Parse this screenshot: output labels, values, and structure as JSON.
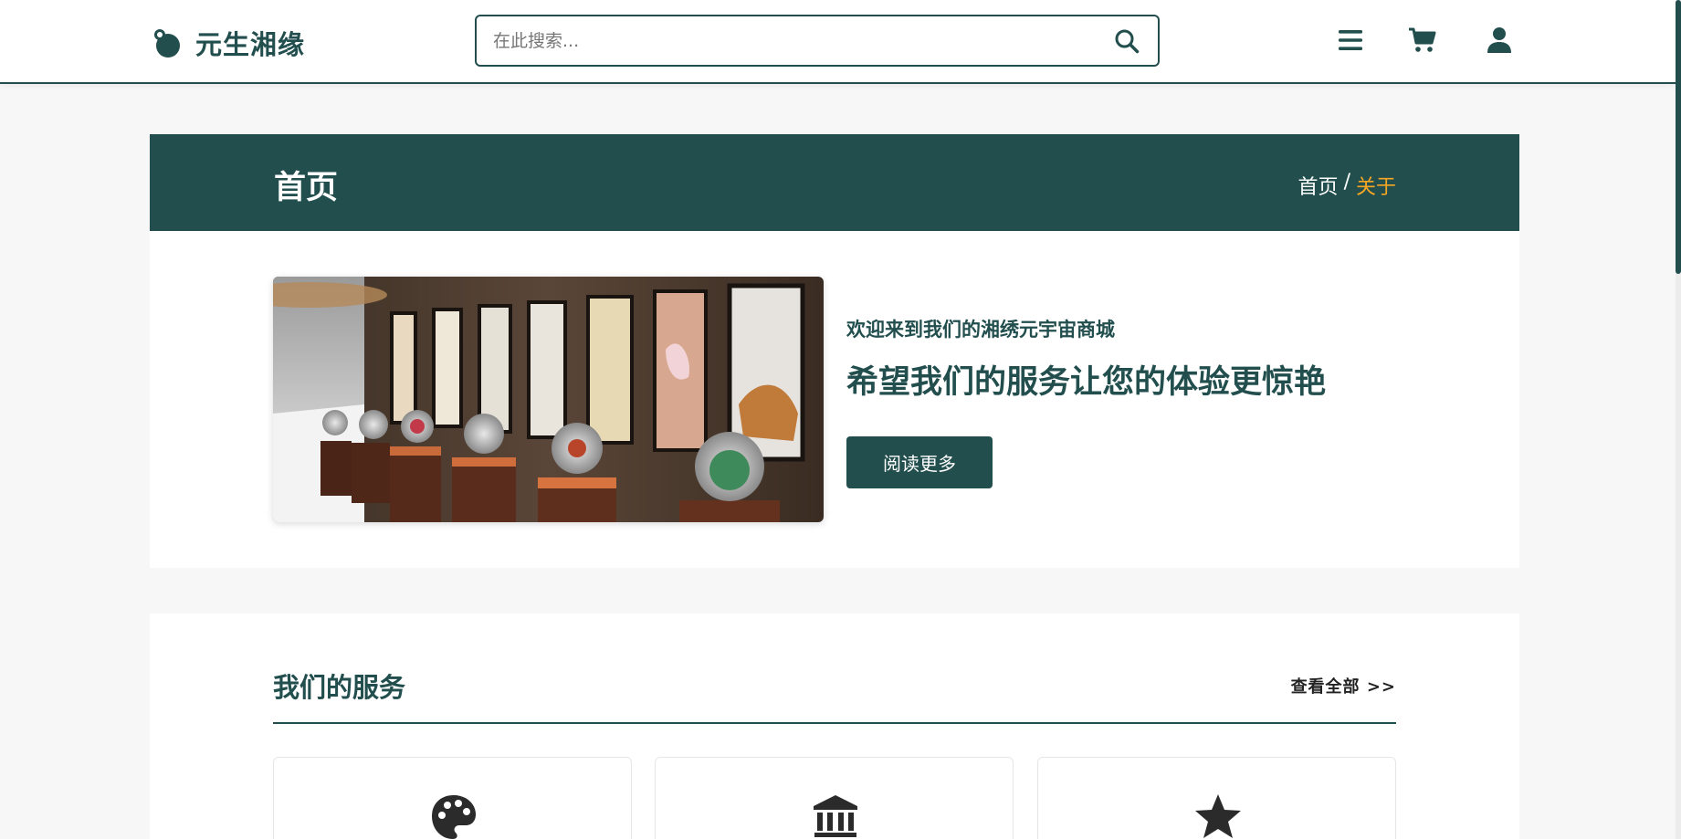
{
  "header": {
    "logo_text": "元生湘缘",
    "search_placeholder": "在此搜索...",
    "icons": [
      "search-icon",
      "menu-icon",
      "cart-icon",
      "user-icon"
    ]
  },
  "banner": {
    "title": "首页",
    "breadcrumb": {
      "home": "首页",
      "separator": "/",
      "current": "关于"
    }
  },
  "about": {
    "image": "virtual-gallery-image",
    "subtitle": "欢迎来到我们的湘绣元宇宙商城",
    "title": "希望我们的服务让您的体验更惊艳",
    "button_label": "阅读更多"
  },
  "services": {
    "title": "我们的服务",
    "view_all": "查看全部 >>",
    "cards": [
      {
        "icon": "palette-icon"
      },
      {
        "icon": "museum-icon"
      },
      {
        "icon": "star-icon"
      }
    ]
  },
  "colors": {
    "primary": "#224e4e",
    "accent": "#f5a623",
    "background": "#f7f7f7",
    "surface": "#ffffff"
  }
}
